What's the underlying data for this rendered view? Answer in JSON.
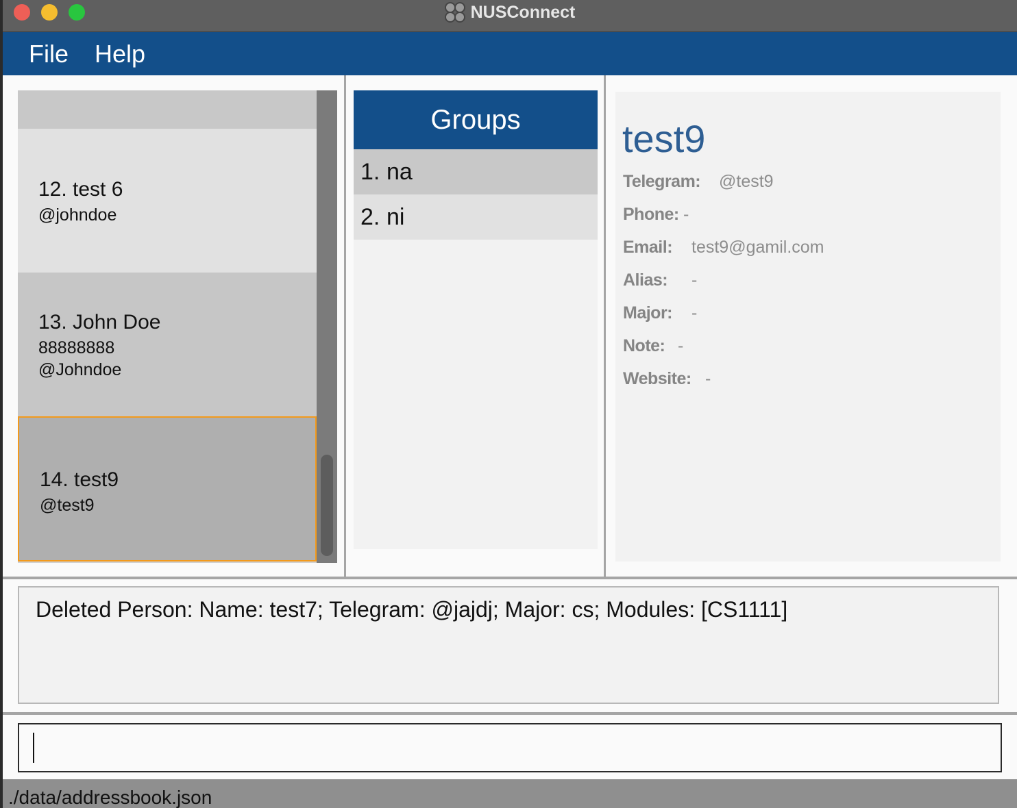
{
  "window": {
    "title": "NUSConnect"
  },
  "menu": {
    "items": [
      {
        "label": "File"
      },
      {
        "label": "Help"
      }
    ]
  },
  "persons": [
    {
      "index_name": "12. test 6",
      "lines": [
        "@johndoe"
      ]
    },
    {
      "index_name": "13. John Doe",
      "lines": [
        "88888888",
        "@Johndoe"
      ]
    },
    {
      "index_name": "14. test9",
      "lines": [
        "@test9"
      ]
    }
  ],
  "groups": {
    "title": "Groups",
    "items": [
      {
        "num": "1.",
        "name": "na"
      },
      {
        "num": "2.",
        "name": "ni"
      }
    ]
  },
  "details": {
    "name": "test9",
    "fields": [
      {
        "label": "Telegram:",
        "value": "@test9"
      },
      {
        "label": "Phone:",
        "value": "-"
      },
      {
        "label": "Email:",
        "value": "test9@gamil.com"
      },
      {
        "label": "Alias:",
        "value": "-"
      },
      {
        "label": "Major:",
        "value": "-"
      },
      {
        "label": "Note:",
        "value": "-"
      },
      {
        "label": "Website:",
        "value": "-"
      }
    ]
  },
  "result": {
    "text": "Deleted Person: Name: test7; Telegram: @jajdj; Major: cs; Modules: [CS1111]"
  },
  "command": {
    "value": "",
    "placeholder": ""
  },
  "status": {
    "path": "./data/addressbook.json"
  },
  "colors": {
    "accent": "#134f8a",
    "selection_border": "#f39a1c",
    "name_color": "#2e5e93"
  }
}
